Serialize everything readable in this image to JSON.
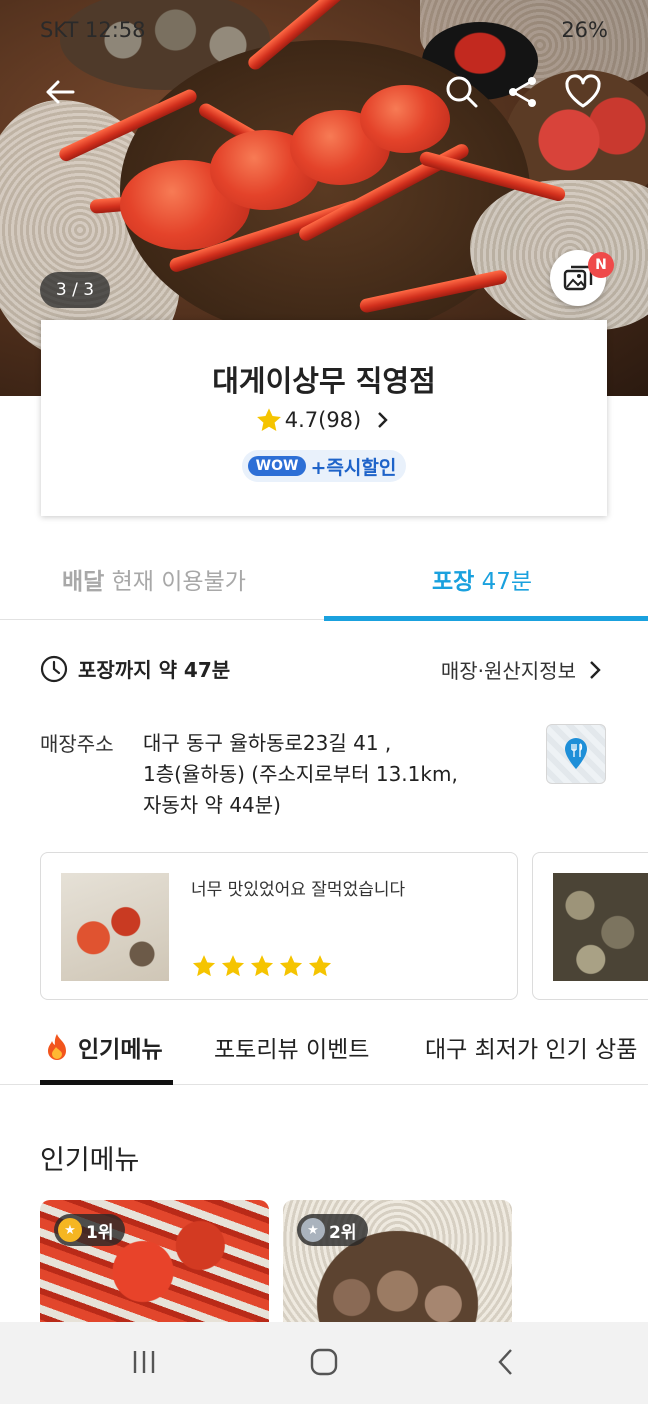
{
  "status_bar": {
    "carrier_time": "SKT 12:58",
    "battery": "26%"
  },
  "gallery": {
    "counter": "3 / 3",
    "new_badge": "N"
  },
  "store": {
    "name": "대게이상무 직영점",
    "rating": "4.7(98)",
    "wow_label": "WOW",
    "instant_discount": "+즉시할인"
  },
  "tabs": {
    "delivery_label": "배달",
    "delivery_status": "현재 이용불가",
    "pickup_label": "포장",
    "pickup_time": "47분"
  },
  "info": {
    "pickup_time_text": "포장까지 약 47분",
    "store_info_link": "매장·원산지정보",
    "address_label": "매장주소",
    "address_lines": [
      "대구 동구 율하동로23길 41 ,",
      "1층(율하동) (주소지로부터 13.1km,",
      "자동차 약 44분)"
    ]
  },
  "reviews": [
    {
      "text": "너무 맛있었어요 잘먹었습니다",
      "stars": 5
    }
  ],
  "menu_tabs": [
    "인기메뉴",
    "포토리뷰 이벤트",
    "대구 최저가 인기 상품"
  ],
  "section_title": "인기메뉴",
  "popular_menu": [
    {
      "rank": "1위",
      "medal": "gold"
    },
    {
      "rank": "2위",
      "medal": "silver"
    }
  ],
  "colors": {
    "accent": "#1aa1de",
    "wow_blue": "#2d6fd6",
    "star": "#f5c400",
    "new_badge": "#ef4a4a"
  }
}
